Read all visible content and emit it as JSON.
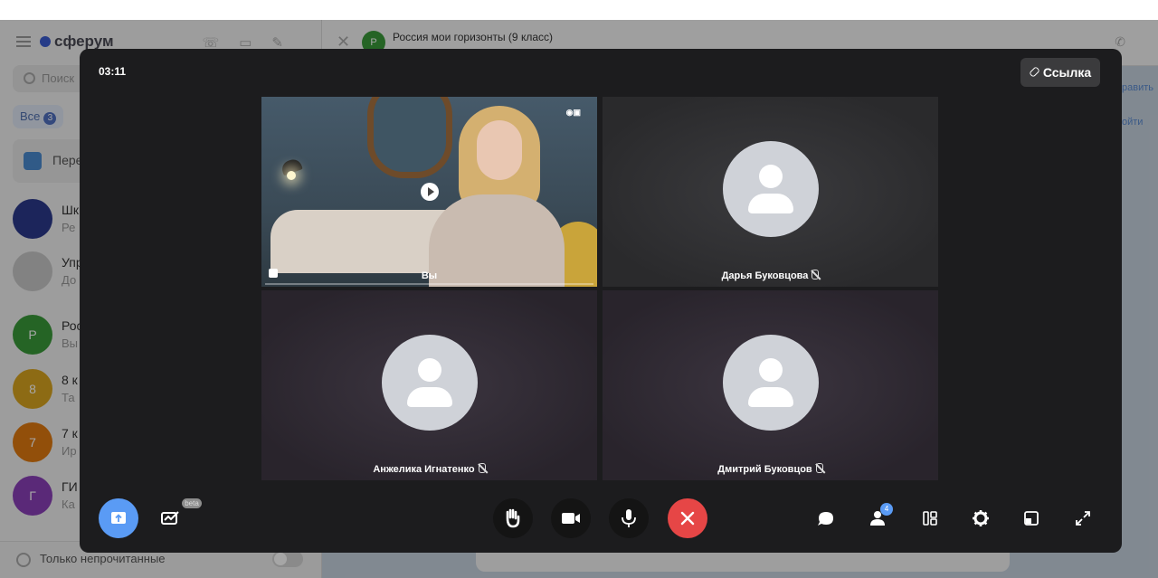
{
  "background_app": {
    "logo": "сферум",
    "search_placeholder": "Поиск",
    "filter": {
      "label": "Все",
      "count": "3"
    },
    "pinned": "Пере",
    "chats": [
      {
        "initial": "",
        "name": "Шк",
        "sub": "Ре",
        "color": "#2c3a8c"
      },
      {
        "initial": "",
        "name": "Упр",
        "sub": "До",
        "color": "#c8c8c8"
      },
      {
        "initial": "Р",
        "name": "Рос",
        "sub": "Вы",
        "color": "#3a9a3a"
      },
      {
        "initial": "8",
        "name": "8 к",
        "sub": "Та",
        "color": "#d9a520"
      },
      {
        "initial": "7",
        "name": "7 к",
        "sub": "Ир",
        "color": "#e07a10"
      },
      {
        "initial": "Г",
        "name": "ГИ",
        "sub": "Ка",
        "color": "#8a3fb8"
      }
    ],
    "unread_only": "Только непрочитанные",
    "chat_header": {
      "initial": "Р",
      "title": "Россия мои горизонты (9 класс)"
    },
    "side_links": [
      "равить",
      "ойти"
    ]
  },
  "call": {
    "timer": "03:11",
    "link_button": "Ссылка",
    "tiles": [
      {
        "name": "Вы",
        "type": "video"
      },
      {
        "name": "Дарья Буковцова",
        "type": "avatar"
      },
      {
        "name": "Анжелика Игнатенко",
        "type": "avatar"
      },
      {
        "name": "Дмитрий Буковцов",
        "type": "avatar"
      }
    ],
    "beta_label": "beta",
    "participants_count": "4"
  }
}
